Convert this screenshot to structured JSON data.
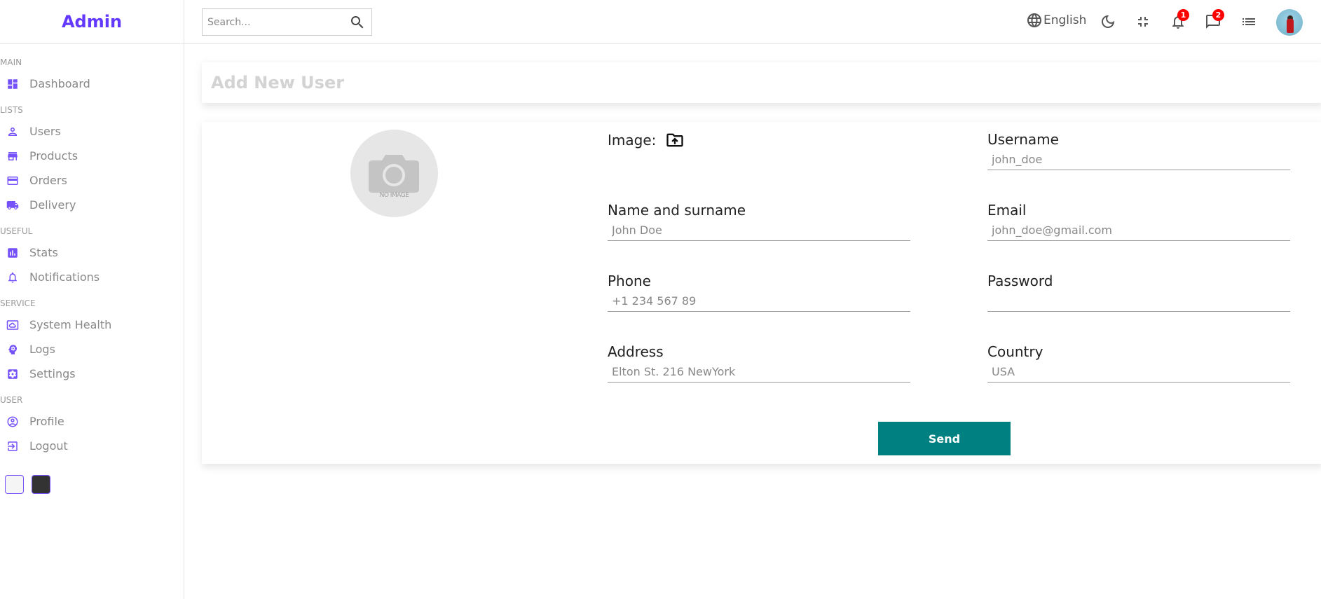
{
  "app": {
    "logo": "Admin"
  },
  "sidebar": {
    "sections": [
      {
        "title": "MAIN",
        "items": [
          {
            "label": "Dashboard",
            "icon": "dashboard-icon"
          }
        ]
      },
      {
        "title": "LISTS",
        "items": [
          {
            "label": "Users",
            "icon": "person-icon"
          },
          {
            "label": "Products",
            "icon": "store-icon"
          },
          {
            "label": "Orders",
            "icon": "credit-card-icon"
          },
          {
            "label": "Delivery",
            "icon": "truck-icon"
          }
        ]
      },
      {
        "title": "USEFUL",
        "items": [
          {
            "label": "Stats",
            "icon": "chart-icon"
          },
          {
            "label": "Notifications",
            "icon": "bell-icon"
          }
        ]
      },
      {
        "title": "SERVICE",
        "items": [
          {
            "label": "System Health",
            "icon": "cloud-icon"
          },
          {
            "label": "Logs",
            "icon": "psychology-icon"
          },
          {
            "label": "Settings",
            "icon": "settings-icon"
          }
        ]
      },
      {
        "title": "USER",
        "items": [
          {
            "label": "Profile",
            "icon": "account-circle-icon"
          },
          {
            "label": "Logout",
            "icon": "logout-icon"
          }
        ]
      }
    ]
  },
  "topbar": {
    "search": {
      "placeholder": "Search..."
    },
    "language": "English",
    "notifications_count": "1",
    "messages_count": "2"
  },
  "page": {
    "title": "Add New User"
  },
  "form": {
    "image_label": "Image:",
    "no_image_text": "NO IMAGE",
    "fields": {
      "username": {
        "label": "Username",
        "placeholder": "john_doe"
      },
      "name": {
        "label": "Name and surname",
        "placeholder": "John Doe"
      },
      "email": {
        "label": "Email",
        "placeholder": "john_doe@gmail.com"
      },
      "phone": {
        "label": "Phone",
        "placeholder": "+1 234 567 89"
      },
      "password": {
        "label": "Password",
        "placeholder": ""
      },
      "address": {
        "label": "Address",
        "placeholder": "Elton St. 216 NewYork"
      },
      "country": {
        "label": "Country",
        "placeholder": "USA"
      }
    },
    "send_label": "Send"
  },
  "colors": {
    "accent": "#6439ff",
    "icon": "#7451f8",
    "send": "#008080",
    "badge": "#ff0000"
  }
}
